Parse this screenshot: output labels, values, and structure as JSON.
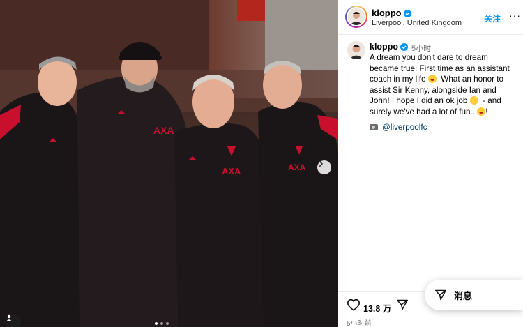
{
  "post": {
    "username": "kloppo",
    "location": "Liverpool, United Kingdom",
    "follow_label": "关注",
    "more_label": "···",
    "caption_author": "kloppo",
    "caption_time": "5小时",
    "caption_lines": [
      "A dream you don't dare to dream",
      "became true: First time as an assistant",
      "coach in my life",
      "What an honor to",
      "assist Sir Kenny, alongside Ian and",
      "John! I hope I did an ok job",
      "- and",
      "surely we've had a lot of fun...",
      "!"
    ],
    "mention": "@liverpoolfc",
    "likes": "13.8 万",
    "post_time": "5小时前",
    "message_label": "消息"
  },
  "carousel": {
    "total": 3,
    "active_index": 0
  },
  "colors": {
    "link_blue": "#0095f6",
    "mention_blue": "#00376b",
    "jacket_black": "#1a1517",
    "liverpool_red": "#c8102e",
    "pitch_green": "#5f9a3a"
  },
  "icons": {
    "verified": "verified-badge-icon",
    "heart": "heart-icon",
    "share": "send-icon",
    "message": "paper-plane-icon",
    "next": "chevron-right-icon",
    "tag": "user-tag-icon"
  }
}
